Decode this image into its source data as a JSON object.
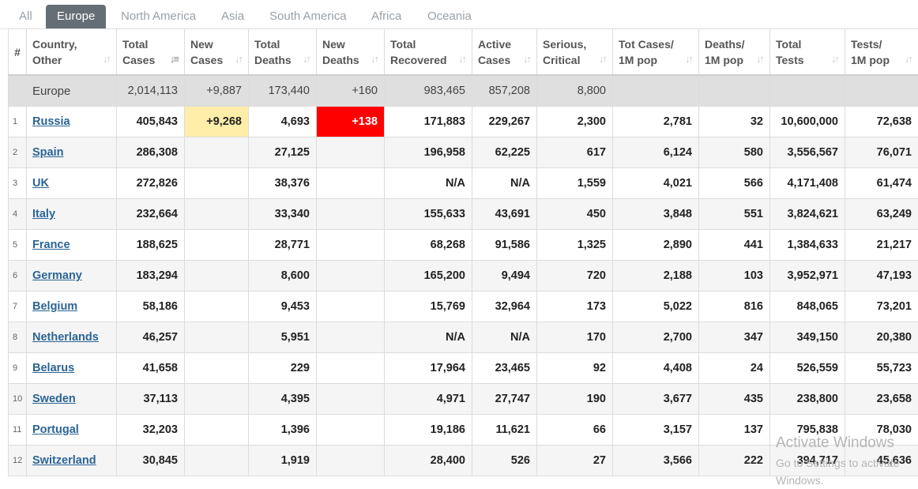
{
  "tabs": [
    "All",
    "Europe",
    "North America",
    "Asia",
    "South America",
    "Africa",
    "Oceania"
  ],
  "active_tab": "Europe",
  "columns": [
    {
      "label_1": "#",
      "label_2": ""
    },
    {
      "label_1": "Country,",
      "label_2": "Other"
    },
    {
      "label_1": "Total",
      "label_2": "Cases"
    },
    {
      "label_1": "New",
      "label_2": "Cases"
    },
    {
      "label_1": "Total",
      "label_2": "Deaths"
    },
    {
      "label_1": "New",
      "label_2": "Deaths"
    },
    {
      "label_1": "Total",
      "label_2": "Recovered"
    },
    {
      "label_1": "Active",
      "label_2": "Cases"
    },
    {
      "label_1": "Serious,",
      "label_2": "Critical"
    },
    {
      "label_1": "Tot Cases/",
      "label_2": "1M pop"
    },
    {
      "label_1": "Deaths/",
      "label_2": "1M pop"
    },
    {
      "label_1": "Total",
      "label_2": "Tests"
    },
    {
      "label_1": "Tests/",
      "label_2": "1M pop"
    }
  ],
  "total_row": {
    "country": "Europe",
    "total_cases": "2,014,113",
    "new_cases": "+9,887",
    "total_deaths": "173,440",
    "new_deaths": "+160",
    "total_recovered": "983,465",
    "active_cases": "857,208",
    "serious": "8,800",
    "cases_per_m": "",
    "deaths_per_m": "",
    "total_tests": "",
    "tests_per_m": ""
  },
  "rows": [
    {
      "idx": "1",
      "country": "Russia",
      "total_cases": "405,843",
      "new_cases": "+9,268",
      "total_deaths": "4,693",
      "new_deaths": "+138",
      "total_recovered": "171,883",
      "active_cases": "229,267",
      "serious": "2,300",
      "cases_per_m": "2,781",
      "deaths_per_m": "32",
      "total_tests": "10,600,000",
      "tests_per_m": "72,638"
    },
    {
      "idx": "2",
      "country": "Spain",
      "total_cases": "286,308",
      "new_cases": "",
      "total_deaths": "27,125",
      "new_deaths": "",
      "total_recovered": "196,958",
      "active_cases": "62,225",
      "serious": "617",
      "cases_per_m": "6,124",
      "deaths_per_m": "580",
      "total_tests": "3,556,567",
      "tests_per_m": "76,071"
    },
    {
      "idx": "3",
      "country": "UK",
      "total_cases": "272,826",
      "new_cases": "",
      "total_deaths": "38,376",
      "new_deaths": "",
      "total_recovered": "N/A",
      "active_cases": "N/A",
      "serious": "1,559",
      "cases_per_m": "4,021",
      "deaths_per_m": "566",
      "total_tests": "4,171,408",
      "tests_per_m": "61,474"
    },
    {
      "idx": "4",
      "country": "Italy",
      "total_cases": "232,664",
      "new_cases": "",
      "total_deaths": "33,340",
      "new_deaths": "",
      "total_recovered": "155,633",
      "active_cases": "43,691",
      "serious": "450",
      "cases_per_m": "3,848",
      "deaths_per_m": "551",
      "total_tests": "3,824,621",
      "tests_per_m": "63,249"
    },
    {
      "idx": "5",
      "country": "France",
      "total_cases": "188,625",
      "new_cases": "",
      "total_deaths": "28,771",
      "new_deaths": "",
      "total_recovered": "68,268",
      "active_cases": "91,586",
      "serious": "1,325",
      "cases_per_m": "2,890",
      "deaths_per_m": "441",
      "total_tests": "1,384,633",
      "tests_per_m": "21,217"
    },
    {
      "idx": "6",
      "country": "Germany",
      "total_cases": "183,294",
      "new_cases": "",
      "total_deaths": "8,600",
      "new_deaths": "",
      "total_recovered": "165,200",
      "active_cases": "9,494",
      "serious": "720",
      "cases_per_m": "2,188",
      "deaths_per_m": "103",
      "total_tests": "3,952,971",
      "tests_per_m": "47,193"
    },
    {
      "idx": "7",
      "country": "Belgium",
      "total_cases": "58,186",
      "new_cases": "",
      "total_deaths": "9,453",
      "new_deaths": "",
      "total_recovered": "15,769",
      "active_cases": "32,964",
      "serious": "173",
      "cases_per_m": "5,022",
      "deaths_per_m": "816",
      "total_tests": "848,065",
      "tests_per_m": "73,201"
    },
    {
      "idx": "8",
      "country": "Netherlands",
      "total_cases": "46,257",
      "new_cases": "",
      "total_deaths": "5,951",
      "new_deaths": "",
      "total_recovered": "N/A",
      "active_cases": "N/A",
      "serious": "170",
      "cases_per_m": "2,700",
      "deaths_per_m": "347",
      "total_tests": "349,150",
      "tests_per_m": "20,380"
    },
    {
      "idx": "9",
      "country": "Belarus",
      "total_cases": "41,658",
      "new_cases": "",
      "total_deaths": "229",
      "new_deaths": "",
      "total_recovered": "17,964",
      "active_cases": "23,465",
      "serious": "92",
      "cases_per_m": "4,408",
      "deaths_per_m": "24",
      "total_tests": "526,559",
      "tests_per_m": "55,723"
    },
    {
      "idx": "10",
      "country": "Sweden",
      "total_cases": "37,113",
      "new_cases": "",
      "total_deaths": "4,395",
      "new_deaths": "",
      "total_recovered": "4,971",
      "active_cases": "27,747",
      "serious": "190",
      "cases_per_m": "3,677",
      "deaths_per_m": "435",
      "total_tests": "238,800",
      "tests_per_m": "23,658"
    },
    {
      "idx": "11",
      "country": "Portugal",
      "total_cases": "32,203",
      "new_cases": "",
      "total_deaths": "1,396",
      "new_deaths": "",
      "total_recovered": "19,186",
      "active_cases": "11,621",
      "serious": "66",
      "cases_per_m": "3,157",
      "deaths_per_m": "137",
      "total_tests": "795,838",
      "tests_per_m": "78,030"
    },
    {
      "idx": "12",
      "country": "Switzerland",
      "total_cases": "30,845",
      "new_cases": "",
      "total_deaths": "1,919",
      "new_deaths": "",
      "total_recovered": "28,400",
      "active_cases": "526",
      "serious": "27",
      "cases_per_m": "3,566",
      "deaths_per_m": "222",
      "total_tests": "394,717",
      "tests_per_m": "45,636"
    }
  ],
  "highlights": {
    "new_cases_color": "#ffeeaa",
    "new_deaths_color": "#ff0000"
  },
  "sort_icon": "sort-arrows-icon",
  "watermark": {
    "line1": "Activate Windows",
    "line2": "Go to Settings to activate Windows."
  }
}
